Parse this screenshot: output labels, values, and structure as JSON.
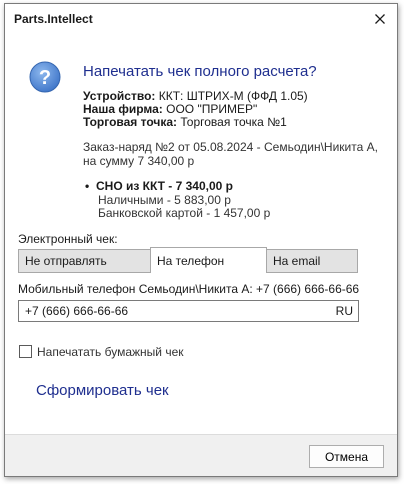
{
  "window": {
    "title": "Parts.Intellect"
  },
  "header": {
    "heading": "Напечатать чек полного расчета?"
  },
  "details": {
    "device_label": "Устройство:",
    "device_value": "ККТ: ШТРИХ-М (ФФД 1.05)",
    "company_label": "Наша фирма:",
    "company_value": "ООО \"ПРИМЕР\"",
    "store_label": "Торговая точка:",
    "store_value": "Торговая точка №1",
    "order_text": "Заказ-наряд №2 от 05.08.2024 - Семьодин\\Никита А, на сумму 7 340,00 р",
    "sno_bullet": "•",
    "sno_text": "СНО из ККТ - 7 340,00 р",
    "cash_text": "Наличными - 5 883,00 р",
    "card_text": "Банковской картой - 1 457,00 р"
  },
  "electronic": {
    "label": "Электронный чек:",
    "tabs": [
      {
        "label": "Не отправлять",
        "active": false
      },
      {
        "label": "На телефон",
        "active": true
      },
      {
        "label": "На email",
        "active": false
      }
    ],
    "phone_label": "Мобильный телефон Семьодин\\Никита А: +7 (666) 666-66-66",
    "phone_value": "+7 (666) 666-66-66",
    "phone_country": "RU"
  },
  "paper": {
    "checkbox_label": "Напечатать бумажный чек",
    "checked": false
  },
  "actions": {
    "form_receipt": "Сформировать чек",
    "cancel": "Отмена"
  },
  "colors": {
    "accent_blue": "#1f2f8f",
    "question_icon": "#5b8fd6"
  }
}
